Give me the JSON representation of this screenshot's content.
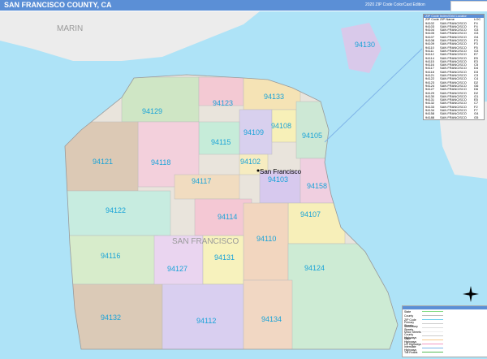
{
  "header": {
    "title": "SAN FRANCISCO COUNTY, CA",
    "edition": "2020 ZIP Code ColorCast Edition",
    "logo_text": "Market MAPS"
  },
  "map": {
    "region_labels": {
      "marin": "MARIN",
      "county": "SAN FRANCISCO",
      "city": "San Francisco"
    },
    "colors": {
      "water": "#aee3f7",
      "land": "#e9e4dc",
      "zip_label": "#19a3d8",
      "header": "#5b8fd6"
    },
    "zips": [
      {
        "code": "94130",
        "color": "#d9c9ea"
      },
      {
        "code": "94129",
        "color": "#cfe6c5"
      },
      {
        "code": "94123",
        "color": "#f3c9d3"
      },
      {
        "code": "94133",
        "color": "#f5e3b5"
      },
      {
        "code": "94109",
        "color": "#d8d0ee"
      },
      {
        "code": "94108",
        "color": "#f7f0b8"
      },
      {
        "code": "94105",
        "color": "#cde8d5"
      },
      {
        "code": "94115",
        "color": "#c6ecd9"
      },
      {
        "code": "94118",
        "color": "#f3d0dc"
      },
      {
        "code": "94121",
        "color": "#dcc9b5"
      },
      {
        "code": "94102",
        "color": "#f6ecc0"
      },
      {
        "code": "94103",
        "color": "#d7c9ee"
      },
      {
        "code": "94158",
        "color": "#f0cfe0"
      },
      {
        "code": "94117",
        "color": "#f1dcc0"
      },
      {
        "code": "94122",
        "color": "#c7ece0"
      },
      {
        "code": "94114",
        "color": "#f4c8d4"
      },
      {
        "code": "94107",
        "color": "#f7efb9"
      },
      {
        "code": "94110",
        "color": "#f2d6bf"
      },
      {
        "code": "94116",
        "color": "#d7eccb"
      },
      {
        "code": "94127",
        "color": "#ead5f0"
      },
      {
        "code": "94131",
        "color": "#f7f2bd"
      },
      {
        "code": "94124",
        "color": "#cdebd4"
      },
      {
        "code": "94132",
        "color": "#dbcab7"
      },
      {
        "code": "94112",
        "color": "#d9cff0"
      },
      {
        "code": "94134",
        "color": "#f1d7c3"
      }
    ]
  },
  "locator": {
    "title": "ZIP Code Index/Grid Locator",
    "headers": [
      "ZIP Code",
      "ZIP Name",
      "LOC"
    ],
    "rows": [
      [
        "94102",
        "SAN FRANCISCO",
        "F4"
      ],
      [
        "94103",
        "SAN FRANCISCO",
        "F4"
      ],
      [
        "94104",
        "SAN FRANCISCO",
        "G3"
      ],
      [
        "94105",
        "SAN FRANCISCO",
        "G3"
      ],
      [
        "94107",
        "SAN FRANCISCO",
        "G4"
      ],
      [
        "94108",
        "SAN FRANCISCO",
        "F3"
      ],
      [
        "94109",
        "SAN FRANCISCO",
        "F3"
      ],
      [
        "94110",
        "SAN FRANCISCO",
        "F5"
      ],
      [
        "94111",
        "SAN FRANCISCO",
        "G3"
      ],
      [
        "94112",
        "SAN FRANCISCO",
        "E7"
      ],
      [
        "94114",
        "SAN FRANCISCO",
        "E5"
      ],
      [
        "94115",
        "SAN FRANCISCO",
        "E3"
      ],
      [
        "94116",
        "SAN FRANCISCO",
        "C5"
      ],
      [
        "94117",
        "SAN FRANCISCO",
        "D4"
      ],
      [
        "94118",
        "SAN FRANCISCO",
        "D3"
      ],
      [
        "94121",
        "SAN FRANCISCO",
        "C3"
      ],
      [
        "94122",
        "SAN FRANCISCO",
        "C4"
      ],
      [
        "94123",
        "SAN FRANCISCO",
        "D2"
      ],
      [
        "94124",
        "SAN FRANCISCO",
        "G6"
      ],
      [
        "94127",
        "SAN FRANCISCO",
        "D6"
      ],
      [
        "94129",
        "SAN FRANCISCO",
        "D2"
      ],
      [
        "94130",
        "SAN FRANCISCO",
        "G1"
      ],
      [
        "94131",
        "SAN FRANCISCO",
        "E5"
      ],
      [
        "94132",
        "SAN FRANCISCO",
        "C7"
      ],
      [
        "94133",
        "SAN FRANCISCO",
        "F2"
      ],
      [
        "94134",
        "SAN FRANCISCO",
        "F7"
      ],
      [
        "94158",
        "SAN FRANCISCO",
        "G4"
      ],
      [
        "94188",
        "SAN FRANCISCO",
        "G5"
      ]
    ]
  },
  "legend": {
    "items": [
      {
        "label": "State",
        "color": "#88dd88"
      },
      {
        "label": "County",
        "color": "#bbbbbb"
      },
      {
        "label": "ZIP Code",
        "color": "#66ccee"
      },
      {
        "label": "Primary Streets",
        "color": "#cccccc"
      },
      {
        "label": "Secondary Streets",
        "color": "#dddddd"
      },
      {
        "label": "Minor Streets",
        "color": "#eeeeee"
      },
      {
        "label": "County Highways",
        "color": "#cccccc"
      },
      {
        "label": "State Highways",
        "color": "#f6c98a"
      },
      {
        "label": "US Highways",
        "color": "#f29ac4"
      },
      {
        "label": "Interstate Highways",
        "color": "#7fb4e8"
      },
      {
        "label": "Toll Roads",
        "color": "#55bb55"
      }
    ]
  }
}
